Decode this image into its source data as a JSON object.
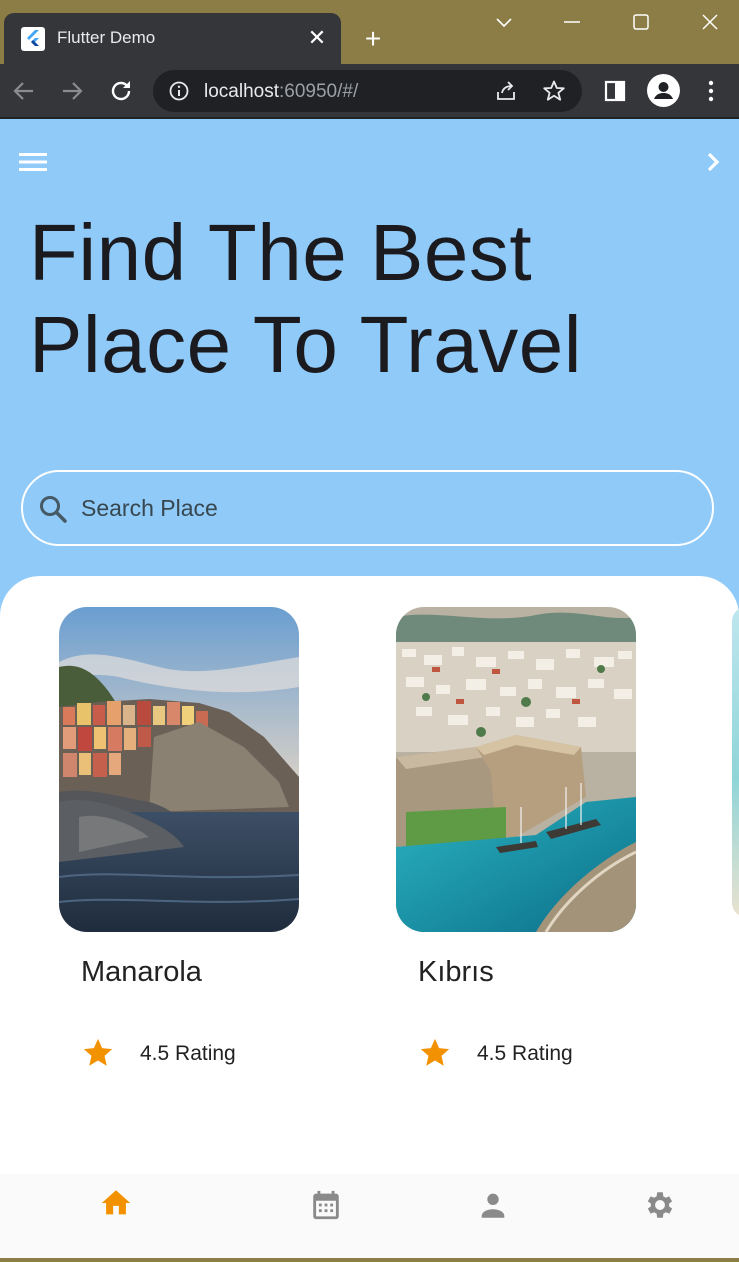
{
  "browser": {
    "tab_title": "Flutter Demo",
    "url_host": "localhost",
    "url_rest": ":60950/#/"
  },
  "app": {
    "headline": "Find The Best Place To Travel",
    "search": {
      "placeholder": "Search Place"
    },
    "places": [
      {
        "name": "Manarola",
        "rating": "4.5 Rating"
      },
      {
        "name": "Kıbrıs",
        "rating": "4.5 Rating"
      }
    ],
    "bottom_nav": [
      {
        "icon": "home-icon",
        "active": true
      },
      {
        "icon": "calendar-icon",
        "active": false
      },
      {
        "icon": "person-icon",
        "active": false
      },
      {
        "icon": "settings-icon",
        "active": false
      }
    ],
    "colors": {
      "background": "#90caf9",
      "accent": "#f39200",
      "inactive_icon": "#8a8a8a"
    }
  }
}
